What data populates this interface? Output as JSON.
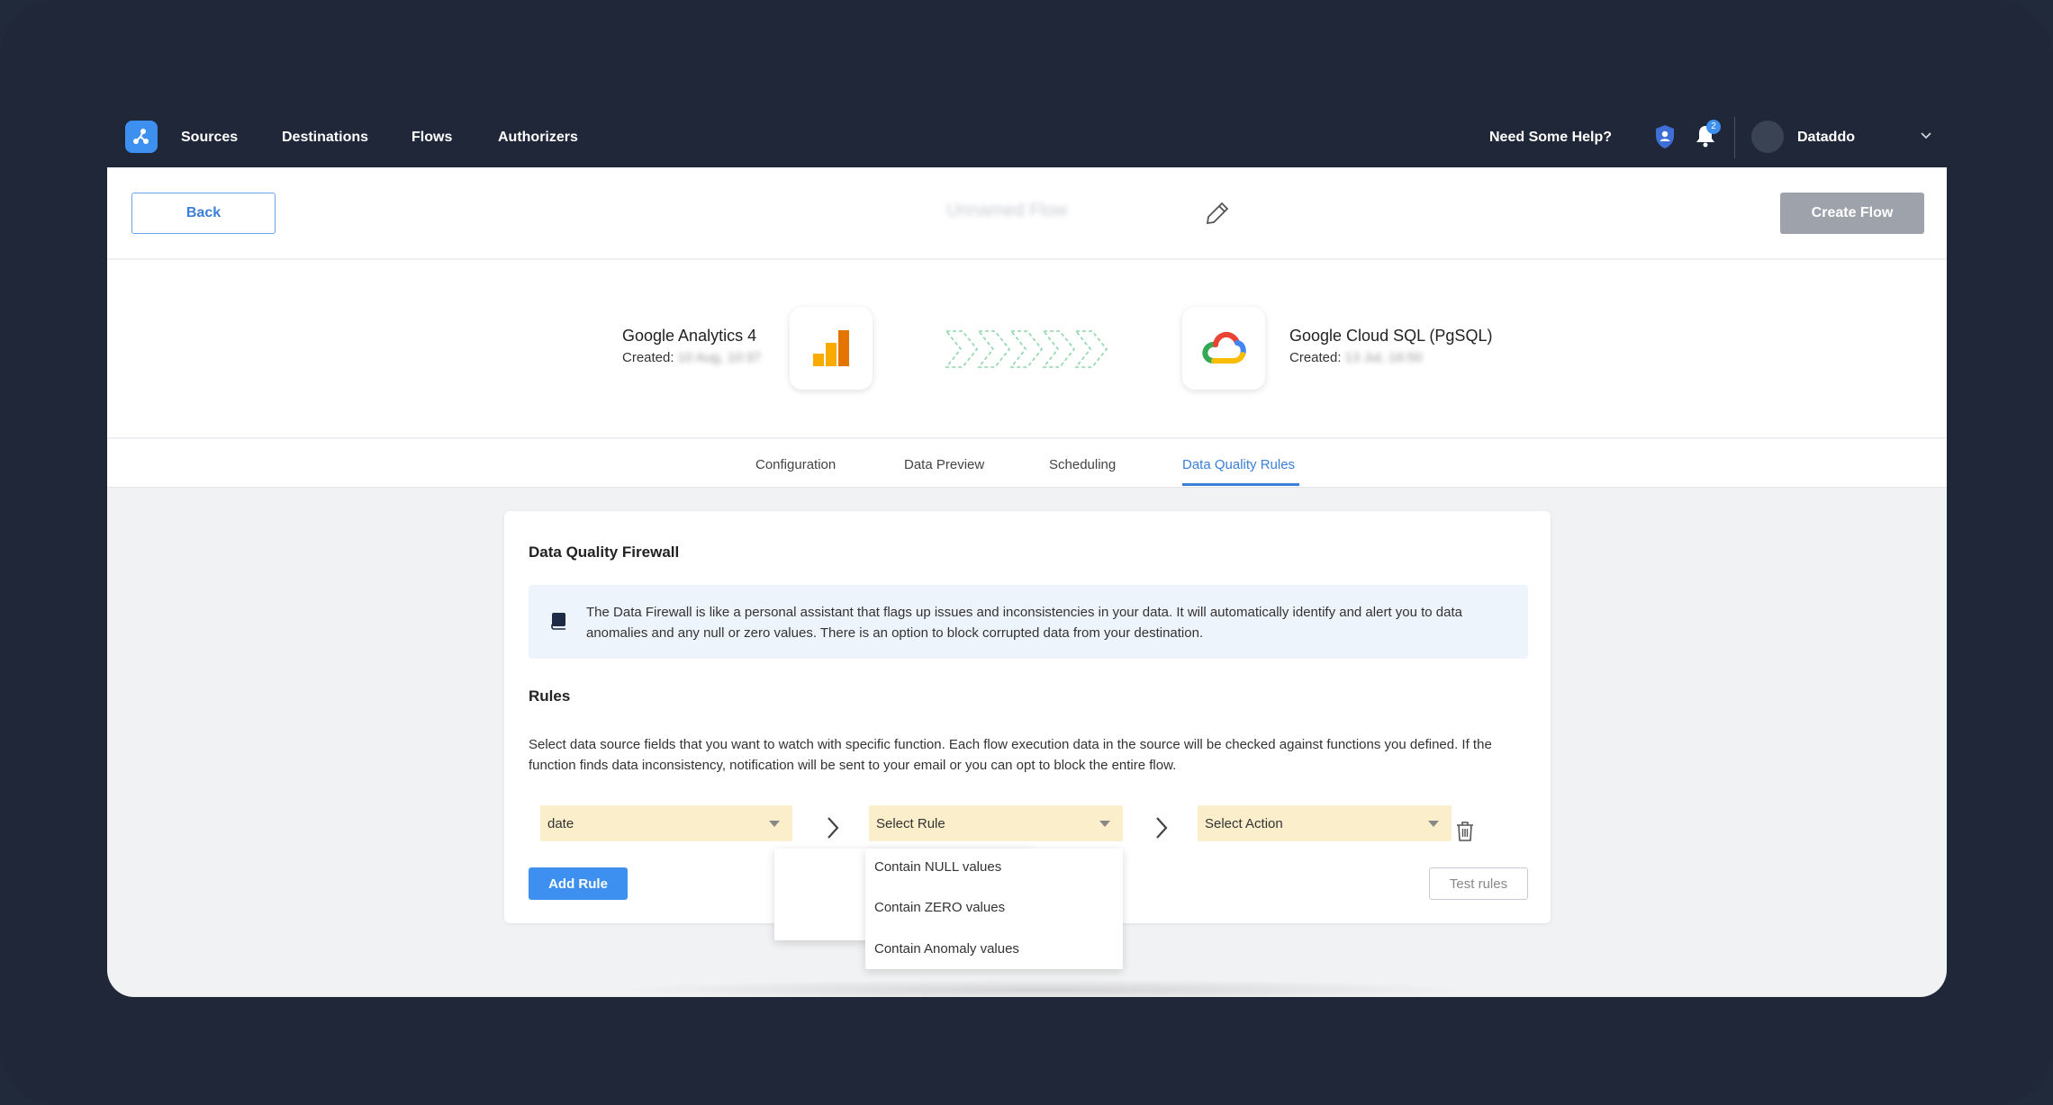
{
  "nav": {
    "links": [
      "Sources",
      "Destinations",
      "Flows",
      "Authorizers"
    ],
    "help": "Need Some Help?",
    "notification_count": "2",
    "user": "Dataddo"
  },
  "header": {
    "back_label": "Back",
    "flow_name": "Unnamed Flow",
    "create_label": "Create Flow"
  },
  "source": {
    "name": "Google Analytics 4",
    "created_label": "Created:",
    "created_value": "10 Aug, 10:37"
  },
  "destination": {
    "name": "Google Cloud SQL (PgSQL)",
    "created_label": "Created:",
    "created_value": "13 Jul, 16:50"
  },
  "tabs": [
    "Configuration",
    "Data Preview",
    "Scheduling",
    "Data Quality Rules"
  ],
  "active_tab": "Data Quality Rules",
  "firewall": {
    "title": "Data Quality Firewall",
    "info": "The Data Firewall is like a personal assistant that flags up issues and inconsistencies in your data. It will automatically identify and alert you to data anomalies and any null or zero values. There is an option to block corrupted data from your destination."
  },
  "rules": {
    "title": "Rules",
    "description": "Select data source fields that you want to watch with specific function. Each flow execution data in the source will be checked against functions you defined. If the function finds data inconsistency, notification will be sent to your email or you can opt to block the entire flow.",
    "field_value": "date",
    "rule_placeholder": "Select Rule",
    "action_placeholder": "Select Action",
    "add_label": "Add Rule",
    "test_label": "Test rules",
    "rule_options": [
      "Contain NULL values",
      "Contain ZERO values",
      "Contain Anomaly values"
    ]
  },
  "colors": {
    "accent": "#3d8ff0",
    "nav_bg": "#1f2738",
    "select_bg": "#fbeecb"
  }
}
